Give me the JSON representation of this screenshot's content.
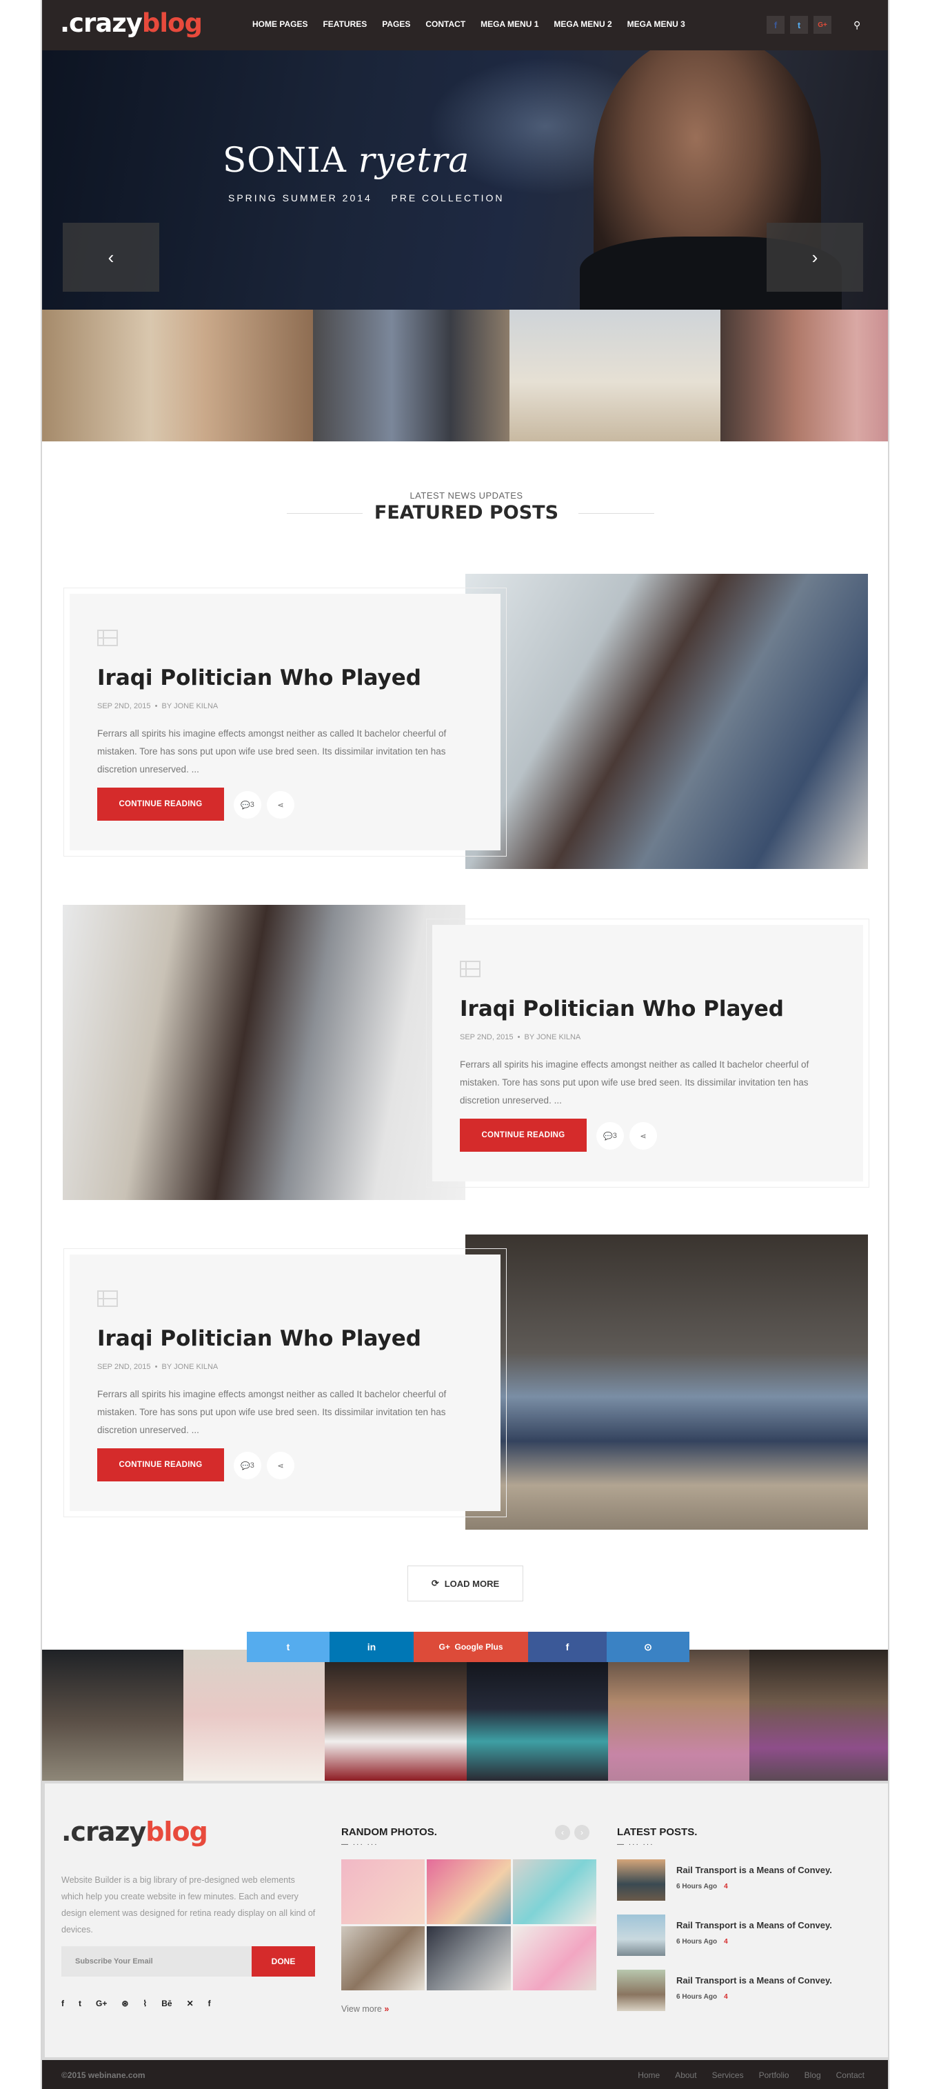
{
  "header": {
    "logo_part1": ".crazy",
    "logo_part2": "blog",
    "nav": [
      "HOME PAGES",
      "FEATURES",
      "PAGES",
      "CONTACT",
      "MEGA MENU 1",
      "MEGA MENU 2",
      "MEGA MENU 3"
    ],
    "social_icons": [
      "facebook-icon",
      "twitter-icon",
      "google-plus-icon"
    ],
    "social_glyphs": [
      "f",
      "t",
      "G+"
    ],
    "search_glyph": "⚲"
  },
  "hero": {
    "title_regular": "SONIA",
    "title_italic": "ryetra",
    "subtitle": "SPRING SUMMER 2014    PRE COLLECTION",
    "prev_glyph": "‹",
    "next_glyph": "›"
  },
  "section": {
    "subtitle": "LATEST NEWS UPDATES",
    "title": "FEATURED POSTS"
  },
  "posts": [
    {
      "title": "Iraqi Politician Who Played",
      "date": "SEP 2ND, 2015",
      "author": "BY JONE KILNA",
      "excerpt": "Ferrars all spirits his imagine effects amongst neither as called It bachelor cheerful of mistaken. Tore has sons put upon wife use bred seen. Its dissimilar invitation ten has discretion unreserved. ...",
      "button": "CONTINUE READING",
      "comments": "3"
    },
    {
      "title": "Iraqi Politician Who Played",
      "date": "SEP 2ND, 2015",
      "author": "BY JONE KILNA",
      "excerpt": "Ferrars all spirits his imagine effects amongst neither as called It bachelor cheerful of mistaken. Tore has sons put upon wife use bred seen. Its dissimilar invitation ten has discretion unreserved. ...",
      "button": "CONTINUE READING",
      "comments": "3"
    },
    {
      "title": "Iraqi Politician Who Played",
      "date": "SEP 2ND, 2015",
      "author": "BY JONE KILNA",
      "excerpt": "Ferrars all spirits his imagine effects amongst neither as called It bachelor cheerful of mistaken. Tore has sons put upon wife use bred seen. Its dissimilar invitation ten has discretion unreserved. ...",
      "button": "CONTINUE READING",
      "comments": "3"
    }
  ],
  "load_more": "LOAD MORE",
  "share_bar": {
    "twitter": "t",
    "linkedin": "in",
    "google_plus": "G+  Google Plus",
    "facebook": "f",
    "github": "⊙",
    "colors": [
      "#55acee",
      "#0077b5",
      "#dd4b39",
      "#3b5998",
      "#3a82c4"
    ]
  },
  "footer": {
    "logo_part1": ".crazy",
    "logo_part2": "blog",
    "about": "Website Builder is a big library of pre-designed web elements which help you create website in few minutes. Each and every design element was designed for retina ready display on all kind of devices.",
    "subscribe_placeholder": "Subscribe Your Email",
    "done": "DONE",
    "social": [
      "f",
      "t",
      "G+",
      "⊛",
      "⌇",
      "Bē",
      "✕",
      "f"
    ],
    "random_photos_title": "RANDOM PHOTOS.",
    "latest_posts_title": "LATEST POSTS.",
    "underline": "— ··· ···",
    "view_more": "View more",
    "latest_posts": [
      {
        "title": "Rail Transport is a Means of Convey.",
        "time": "6 Hours Ago",
        "count": "4"
      },
      {
        "title": "Rail Transport is a Means of Convey.",
        "time": "6 Hours Ago",
        "count": "4"
      },
      {
        "title": "Rail Transport is a Means of Convey.",
        "time": "6 Hours Ago",
        "count": "4"
      }
    ]
  },
  "bottom": {
    "copyright": "©2015 webinane.com",
    "links": [
      "Home",
      "About",
      "Services",
      "Portfolio",
      "Blog",
      "Contact"
    ]
  }
}
